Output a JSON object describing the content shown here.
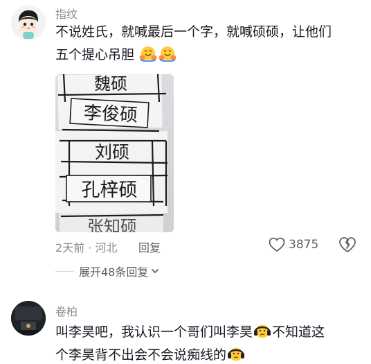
{
  "comments": [
    {
      "username": "指纹",
      "text_line1": "不说姓氏，就喊最后一个字，就喊硕硕，让他们",
      "text_line2": "五个提心吊胆",
      "emoji_name": "hugging-face-icon",
      "photo": {
        "names": [
          "魏硕",
          "李俊硕",
          "刘硕",
          "孔梓硕",
          "张知硕"
        ]
      },
      "time": "2天前",
      "separator": "·",
      "location": "河北",
      "reply_label": "回复",
      "like_count": "3875",
      "expand_label": "展开48条回复"
    },
    {
      "username": "卷柏",
      "text_part1": "叫李昊吧，我认识一个哥们叫李昊",
      "text_part2": "不知道这",
      "text_part3": "个李昊背不出会不会说痴线的",
      "emoji_name": "headphones-face-icon"
    }
  ]
}
